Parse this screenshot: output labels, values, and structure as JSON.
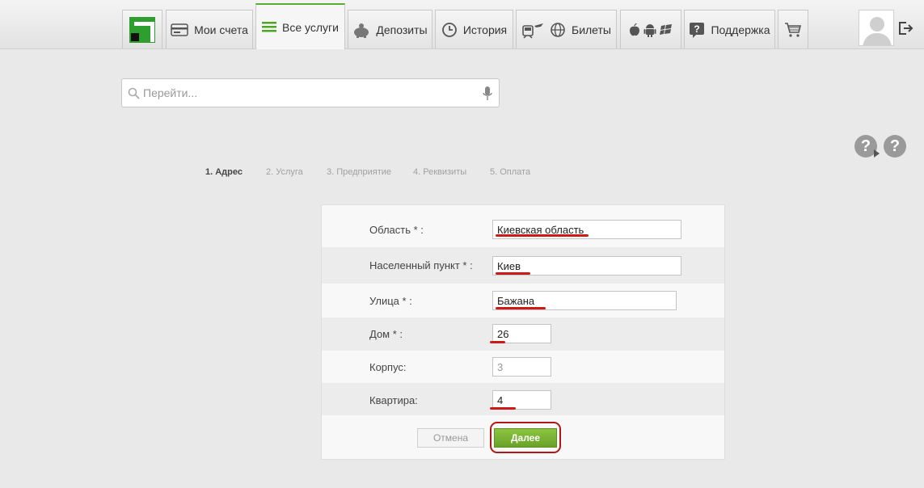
{
  "nav": {
    "tabs": [
      {
        "label": "Мои счета",
        "icon": "card-icon"
      },
      {
        "label": "Все услуги",
        "icon": "list-icon",
        "active": true
      },
      {
        "label": "Депозиты",
        "icon": "piggy-bank-icon"
      },
      {
        "label": "История",
        "icon": "history-icon"
      },
      {
        "label": "Билеты",
        "icon": "train-plane-icon"
      },
      {
        "label": "",
        "icon": "mobile-apps-icon"
      },
      {
        "label": "Поддержка",
        "icon": "support-icon"
      },
      {
        "label": "",
        "icon": "cart-icon"
      }
    ]
  },
  "search": {
    "placeholder": "Перейти..."
  },
  "steps": [
    {
      "label": "1. Адрес",
      "active": true
    },
    {
      "label": "2. Услуга"
    },
    {
      "label": "3. Предприятие"
    },
    {
      "label": "4. Реквизиты"
    },
    {
      "label": "5. Оплата"
    }
  ],
  "form": {
    "fields": [
      {
        "label": "Область * :",
        "value": "Киевская область"
      },
      {
        "label": "Населенный пункт * :",
        "value": "Киев"
      },
      {
        "label": "Улица * :",
        "value": "Бажана"
      },
      {
        "label": "Дом * :",
        "value": "26"
      },
      {
        "label": "Корпус:",
        "value": "3"
      },
      {
        "label": "Квартира:",
        "value": "4"
      }
    ],
    "cancel_label": "Отмена",
    "next_label": "Далее"
  },
  "colors": {
    "accent": "#5aae2f",
    "annotation": "#cc1a1a"
  }
}
